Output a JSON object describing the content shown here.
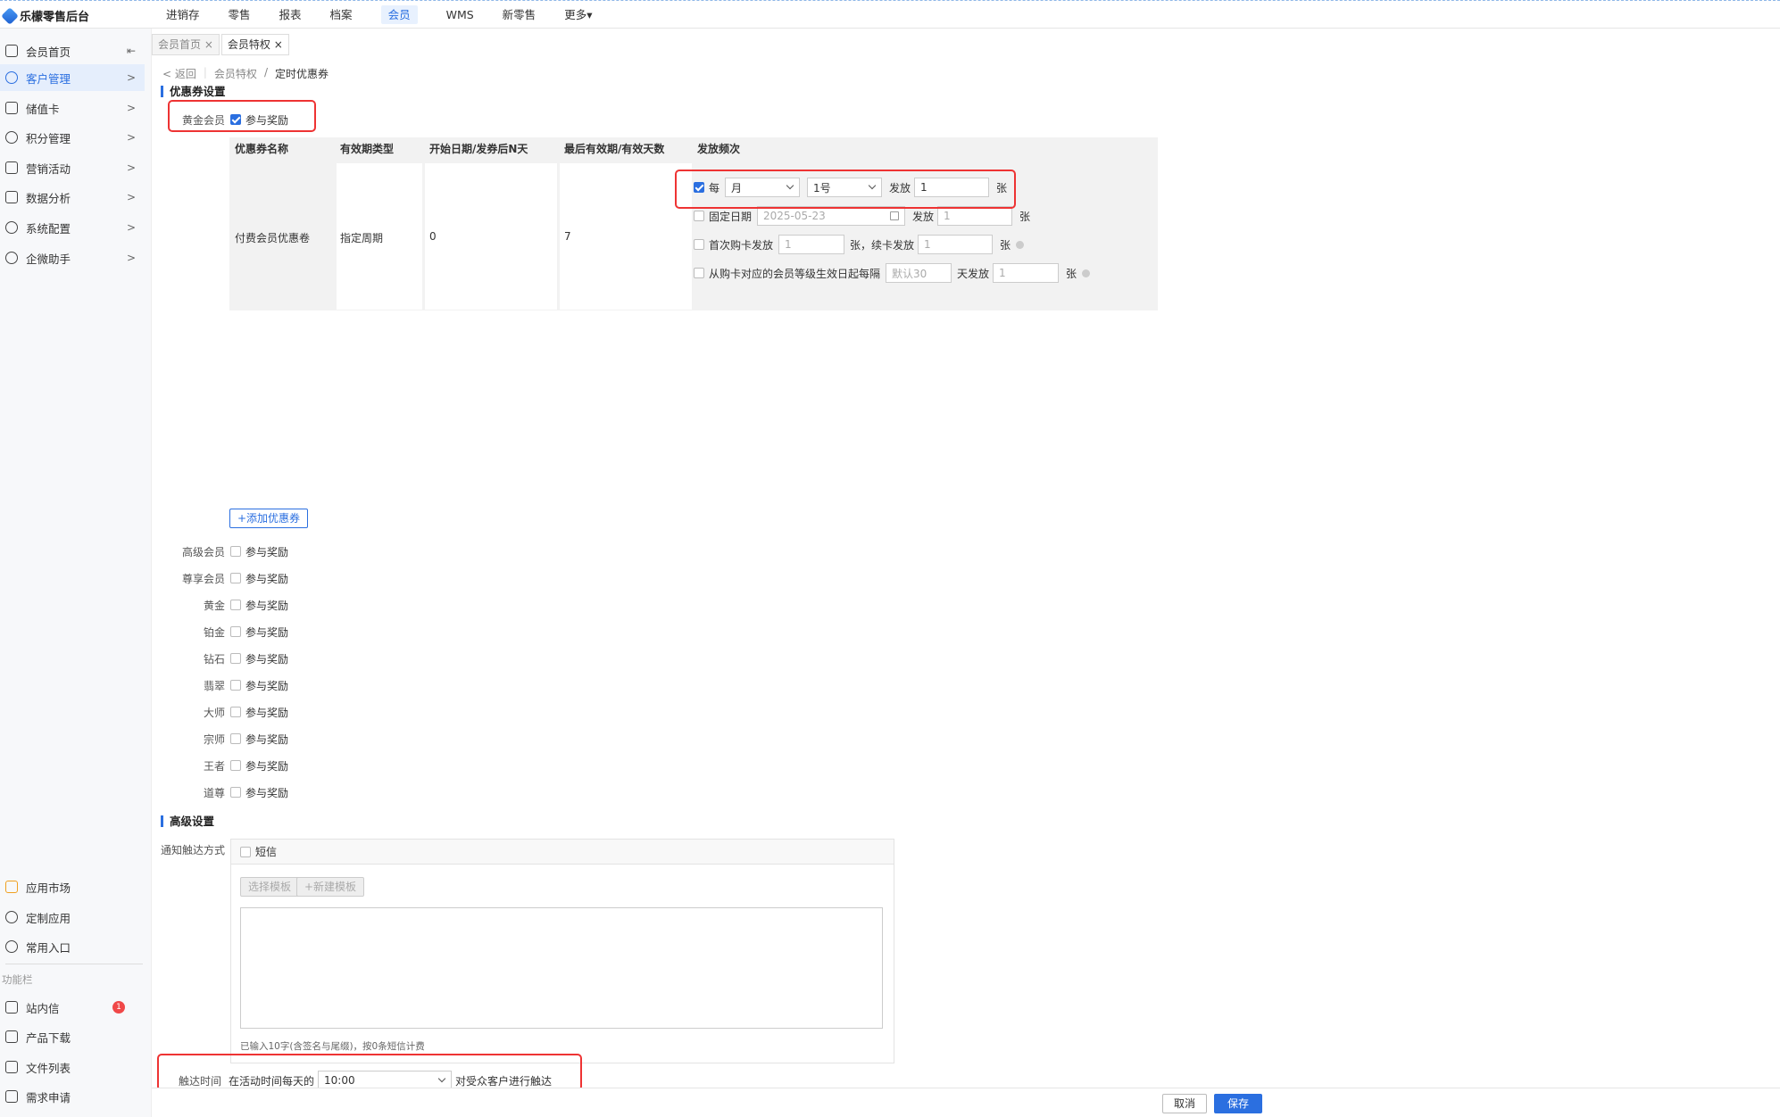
{
  "app": {
    "title": "乐檬零售后台"
  },
  "topnav": [
    "进销存",
    "零售",
    "报表",
    "档案",
    "会员",
    "WMS",
    "新零售",
    "更多▾"
  ],
  "sidebar": {
    "items": [
      {
        "label": "会员首页",
        "chev": "⇤",
        "icon": "home-icon"
      },
      {
        "label": "客户管理",
        "chev": ">",
        "icon": "user-icon"
      },
      {
        "label": "储值卡",
        "chev": ">",
        "icon": "card-icon"
      },
      {
        "label": "积分管理",
        "chev": ">",
        "icon": "coins-icon"
      },
      {
        "label": "营销活动",
        "chev": ">",
        "icon": "campaign-icon"
      },
      {
        "label": "数据分析",
        "chev": ">",
        "icon": "chart-icon"
      },
      {
        "label": "系统配置",
        "chev": ">",
        "icon": "gear-icon"
      },
      {
        "label": "企微助手",
        "chev": ">",
        "icon": "chat-icon"
      }
    ],
    "bottom_items": [
      {
        "label": "应用市场",
        "icon": "app-market-icon"
      },
      {
        "label": "定制应用",
        "icon": "custom-app-icon"
      },
      {
        "label": "常用入口",
        "icon": "heart-icon"
      }
    ],
    "caption": "功能栏",
    "func_items": [
      {
        "label": "站内信",
        "icon": "mail-icon",
        "badge": "1"
      },
      {
        "label": "产品下载",
        "icon": "download-icon"
      },
      {
        "label": "文件列表",
        "icon": "file-list-icon"
      },
      {
        "label": "需求申请",
        "icon": "request-icon"
      }
    ]
  },
  "tabs": [
    {
      "label": "会员首页 ×"
    },
    {
      "label": "会员特权 ×"
    }
  ],
  "breadcrumb": {
    "back": "< 返回",
    "parent": "会员特权",
    "sep": "/",
    "current": "定时优惠券"
  },
  "coupon_section": {
    "title": "优惠券设置"
  },
  "gold_member": {
    "label": "黄金会员",
    "checkbox_label": "参与奖励"
  },
  "table": {
    "headers": [
      "优惠券名称",
      "有效期类型",
      "开始日期/发券后N天",
      "最后有效期/有效天数",
      "发放频次"
    ],
    "row": {
      "name": "付费会员优惠卷",
      "validity_type": "指定周期",
      "start": "0",
      "end": "7"
    },
    "freq": {
      "every_label": "每",
      "period": "月",
      "day": "1号",
      "issue_label": "发放",
      "qty": "1",
      "unit": "张",
      "fixed_date_label": "固定日期",
      "fixed_date": "2025-05-23",
      "fixed_qty": "1",
      "first_buy_label": "首次购卡发放",
      "first_buy_qty": "1",
      "renew_label": "张，续卡发放",
      "renew_qty": "1",
      "from_buy_label": "从购卡对应的会员等级生效日起每隔",
      "interval_placeholder": "默认30",
      "days_issue_label": "天发放",
      "days_qty": "1"
    }
  },
  "add_coupon_button": "+添加优惠券",
  "levels": [
    {
      "label": "高级会员",
      "cb": "参与奖励"
    },
    {
      "label": "尊享会员",
      "cb": "参与奖励"
    },
    {
      "label": "黄金",
      "cb": "参与奖励"
    },
    {
      "label": "铂金",
      "cb": "参与奖励"
    },
    {
      "label": "钻石",
      "cb": "参与奖励"
    },
    {
      "label": "翡翠",
      "cb": "参与奖励"
    },
    {
      "label": "大师",
      "cb": "参与奖励"
    },
    {
      "label": "宗师",
      "cb": "参与奖励"
    },
    {
      "label": "王者",
      "cb": "参与奖励"
    },
    {
      "label": "道尊",
      "cb": "参与奖励"
    }
  ],
  "advanced": {
    "title": "高级设置",
    "notify_label": "通知触达方式",
    "sms_label": "短信",
    "select_template": "选择模板",
    "new_template": "+新建模板",
    "hint": "已输入10字(含签名与尾缀)，按0条短信计费",
    "touch_label": "触达时间",
    "touch_prefix": "在活动时间每天的",
    "touch_time": "10:00",
    "touch_suffix": "对受众客户进行触达"
  },
  "footer": {
    "cancel": "取消",
    "save": "保存"
  },
  "colors": {
    "accent": "#2b6fe0",
    "highlight": "#e33333",
    "badge": "#f04848"
  }
}
